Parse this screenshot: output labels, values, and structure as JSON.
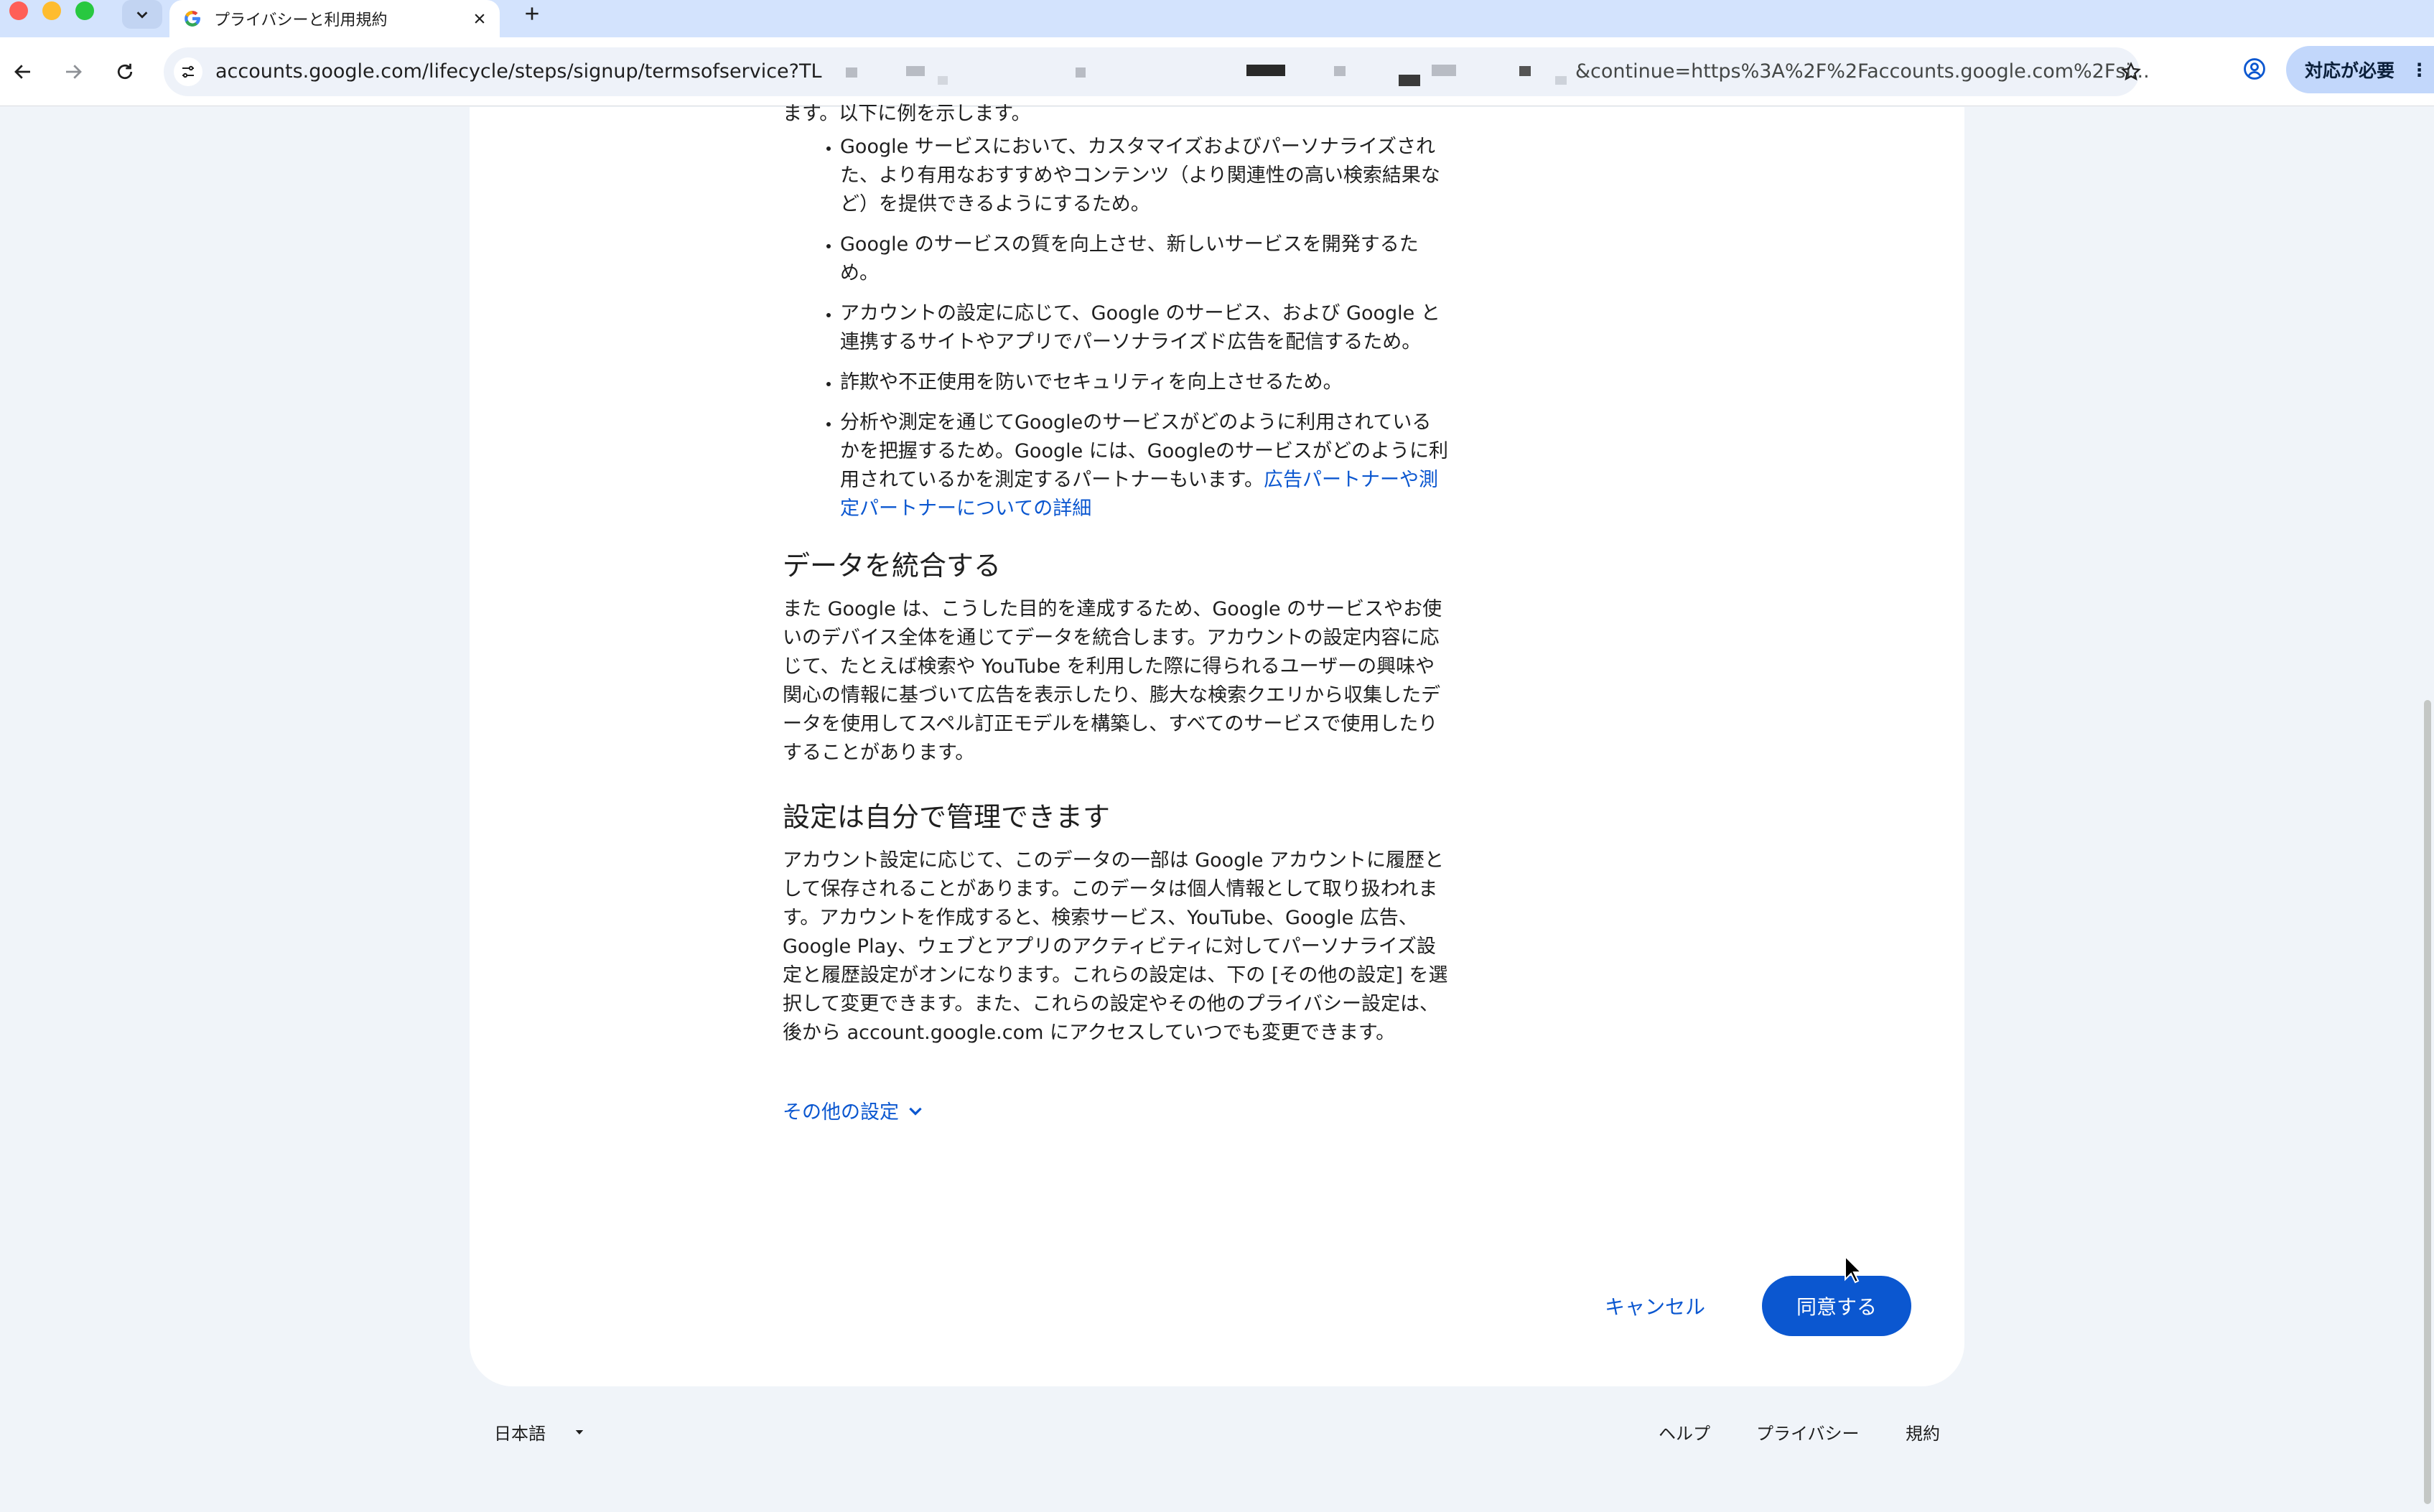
{
  "browser": {
    "tab_title": "プライバシーと利用規約",
    "url_main": "accounts.google.com/lifecycle/steps/signup/termsofservice?TL",
    "url_tail": "&continue=https%3A%2F%2Faccounts.google.com%2Fsi...",
    "action_needed_label": "対応が必要",
    "icons": [
      "back-icon",
      "forward-icon",
      "reload-icon",
      "tune-icon",
      "star-icon",
      "profile-icon",
      "more-icon",
      "close-icon",
      "plus-icon",
      "chevron-down-icon"
    ]
  },
  "content": {
    "intro": "ます。以下に例を示します。",
    "bullets": [
      {
        "text": "Google サービスにおいて、カスタマイズおよびパーソナライズされた、より有用なおすすめやコンテンツ（より関連性の高い検索結果など）を提供できるようにするため。"
      },
      {
        "text": "Google のサービスの質を向上させ、新しいサービスを開発するため。"
      },
      {
        "text": "アカウントの設定に応じて、Google のサービス、および Google と連携するサイトやアプリでパーソナライズド広告を配信するため。"
      },
      {
        "text": "詐欺や不正使用を防いでセキュリティを向上させるため。"
      },
      {
        "text": "分析や測定を通じてGoogleのサービスがどのように利用されているかを把握するため。Google には、Googleのサービスがどのように利用されているかを測定するパートナーもいます。",
        "link": "広告パートナーや測定パートナーについての詳細"
      }
    ],
    "section1_heading": "データを統合する",
    "section1_body": "また Google は、こうした目的を達成するため、Google のサービスやお使いのデバイス全体を通じてデータを統合します。アカウントの設定内容に応じて、たとえば検索や YouTube を利用した際に得られるユーザーの興味や関心の情報に基づいて広告を表示したり、膨大な検索クエリから収集したデータを使用してスペル訂正モデルを構築し、すべてのサービスで使用したりすることがあります。",
    "section2_heading": "設定は自分で管理できます",
    "section2_body": "アカウント設定に応じて、このデータの一部は Google アカウントに履歴として保存されることがあります。このデータは個人情報として取り扱われます。アカウントを作成すると、検索サービス、YouTube、Google 広告、Google Play、ウェブとアプリのアクティビティに対してパーソナライズ設定と履歴設定がオンになります。これらの設定は、下の [その他の設定] を選択して変更できます。また、これらの設定やその他のプライバシー設定は、後から account.google.com にアクセスしていつでも変更できます。",
    "more_settings": "その他の設定",
    "cancel": "キャンセル",
    "agree": "同意する"
  },
  "footer": {
    "language": "日本語",
    "help": "ヘルプ",
    "privacy": "プライバシー",
    "terms": "規約"
  },
  "colors": {
    "accent": "#0b57d0",
    "tabstrip": "#d3e3fd",
    "page_bg": "#f0f4f9"
  }
}
